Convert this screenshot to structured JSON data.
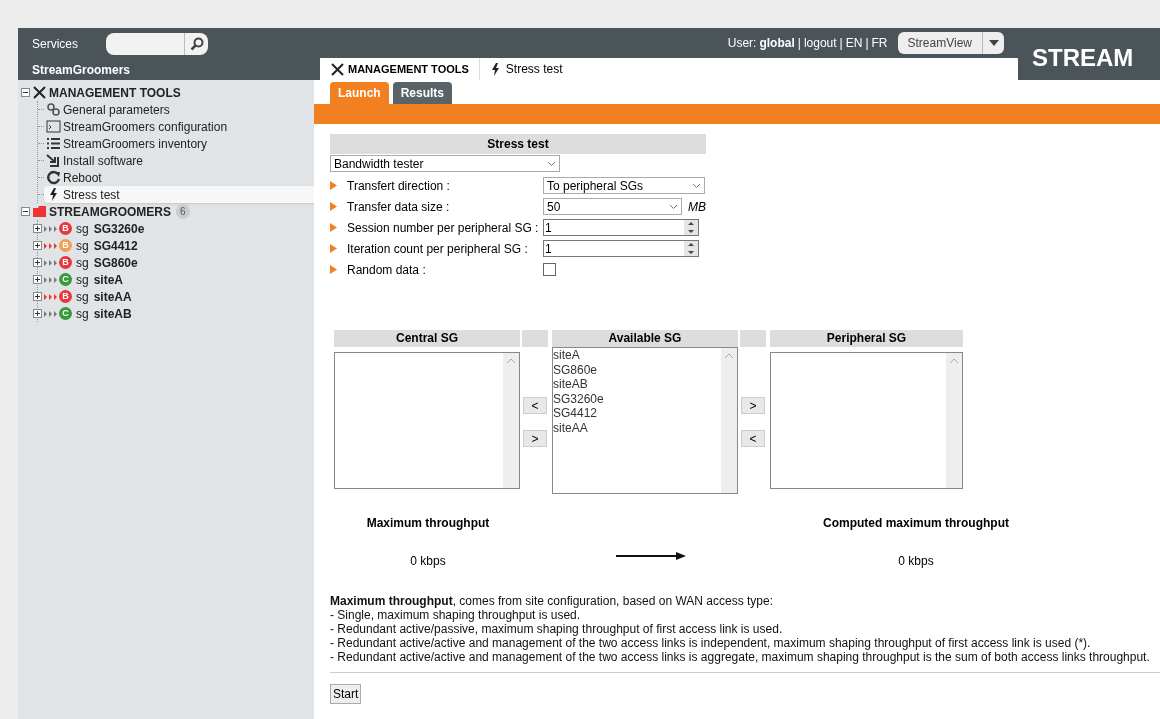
{
  "header": {
    "services_label": "Services",
    "section_title": "StreamGroomers",
    "user_prefix": "User:",
    "user": "global",
    "links": [
      "logout",
      "EN",
      "FR"
    ],
    "separator": "|",
    "view_select": "StreamView",
    "logo": "STREAM"
  },
  "tree": [
    {
      "label": "MANAGEMENT TOOLS",
      "kind": "tools",
      "expanded": true,
      "children": [
        {
          "label": "General parameters",
          "kind": "gears",
          "selected": false
        },
        {
          "label": "StreamGroomers configuration",
          "kind": "terminal",
          "selected": false
        },
        {
          "label": "StreamGroomers inventory",
          "kind": "list",
          "selected": false
        },
        {
          "label": "Install software",
          "kind": "install",
          "selected": false
        },
        {
          "label": "Reboot",
          "kind": "reload",
          "selected": false
        },
        {
          "label": "Stress test",
          "kind": "bolt",
          "selected": true
        }
      ]
    },
    {
      "label": "STREAMGROOMERS",
      "kind": "folder",
      "count": "6",
      "expanded": true,
      "children": [
        {
          "prefix": "sg",
          "name": "SG3260e",
          "badge": "B",
          "color": "#e8383d",
          "alert": false,
          "expanded": false
        },
        {
          "prefix": "sg",
          "name": "SG4412",
          "badge": "B",
          "color": "#f0a050",
          "alert": true,
          "expanded": false
        },
        {
          "prefix": "sg",
          "name": "SG860e",
          "badge": "B",
          "color": "#e8383d",
          "alert": false,
          "expanded": false
        },
        {
          "prefix": "sg",
          "name": "siteA",
          "badge": "C",
          "color": "#3a9a3a",
          "alert": false,
          "expanded": false
        },
        {
          "prefix": "sg",
          "name": "siteAA",
          "badge": "B",
          "color": "#e8383d",
          "alert": true,
          "expanded": false
        },
        {
          "prefix": "sg",
          "name": "siteAB",
          "badge": "C",
          "color": "#3a9a3a",
          "alert": false,
          "expanded": false
        }
      ]
    }
  ],
  "breadcrumb": [
    {
      "label": "MANAGEMENT TOOLS",
      "kind": "tools"
    },
    {
      "label": "Stress test",
      "kind": "bolt"
    }
  ],
  "subtabs": [
    {
      "label": "Launch",
      "selected": true
    },
    {
      "label": "Results",
      "selected": false
    }
  ],
  "form": {
    "title": "Stress test",
    "test_type": "Bandwidth tester",
    "fields": [
      {
        "label": "Transfert direction :",
        "kind": "select",
        "value": "To peripheral SGs"
      },
      {
        "label": "Transfer data size :",
        "kind": "select",
        "value": "50",
        "unit": "MB"
      },
      {
        "label": "Session number per peripheral SG :",
        "kind": "number",
        "value": "1"
      },
      {
        "label": "Iteration count per peripheral SG :",
        "kind": "number",
        "value": "1"
      },
      {
        "label": "Random data :",
        "kind": "checkbox",
        "checked": false
      }
    ]
  },
  "lists": {
    "central": {
      "title": "Central SG"
    },
    "available": {
      "title": "Available SG",
      "items": [
        "siteA",
        "SG860e",
        "siteAB",
        "SG3260e",
        "SG4412",
        "siteAA"
      ]
    },
    "peripheral": {
      "title": "Peripheral SG"
    },
    "left_buttons": [
      "<",
      ">"
    ],
    "right_buttons": [
      ">",
      "<"
    ]
  },
  "throughput": {
    "left_label": "Maximum throughput",
    "left_value": "0 kbps",
    "right_label": "Computed maximum throughput",
    "right_value": "0 kbps"
  },
  "notes": [
    "**Maximum throughput**, comes from site configuration, based on WAN access type:",
    "- Single, maximum shaping throughput is used.",
    "- Redundant active/passive, maximum shaping throughput of first access link is used.",
    "- Redundant active/active and management of the two access links is independent, maximum shaping throughput of first access link is used (*).",
    "- Redundant active/active and management of the two access links is aggregate, maximum shaping throughput is the sum of both access links throughput."
  ],
  "start_button": "Start"
}
